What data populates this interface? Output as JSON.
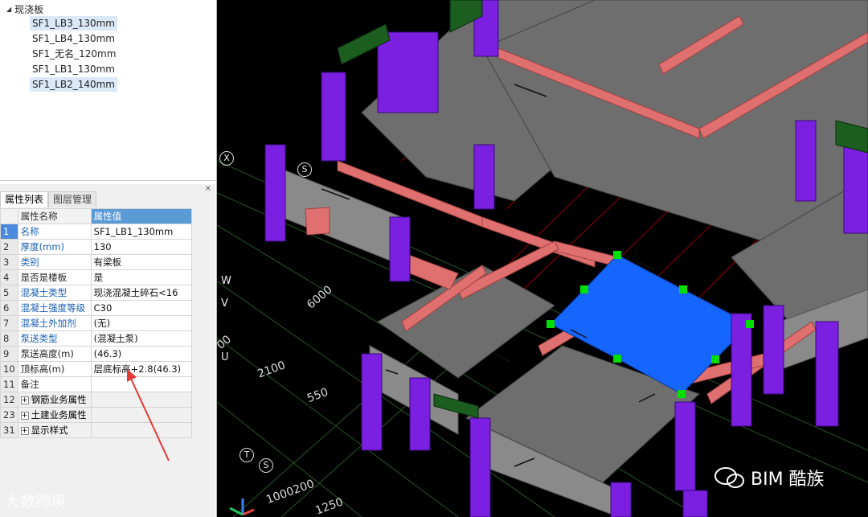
{
  "tree": {
    "root_label": "现浇板",
    "items": [
      {
        "label": "SF1_LB3_130mm",
        "selected": true
      },
      {
        "label": "SF1_LB4_130mm",
        "selected": false
      },
      {
        "label": "SF1_无名_120mm",
        "selected": false
      },
      {
        "label": "SF1_LB1_130mm",
        "selected": false
      },
      {
        "label": "SF1_LB2_140mm",
        "selected": true
      }
    ]
  },
  "panel": {
    "close_label": "×",
    "tabs": [
      {
        "label": "属性列表",
        "active": true
      },
      {
        "label": "图层管理",
        "active": false
      }
    ],
    "headers": {
      "name": "属性名称",
      "value": "属性值"
    },
    "rows": [
      {
        "num": "1",
        "name": "名称",
        "value": "SF1_LB1_130mm",
        "blue": true
      },
      {
        "num": "2",
        "name": "厚度(mm)",
        "value": "130",
        "blue": true
      },
      {
        "num": "3",
        "name": "类别",
        "value": "有梁板",
        "blue": true
      },
      {
        "num": "4",
        "name": "是否是楼板",
        "value": "是",
        "blue": false
      },
      {
        "num": "5",
        "name": "混凝土类型",
        "value": "现浇混凝土碎石<16",
        "blue": true
      },
      {
        "num": "6",
        "name": "混凝土强度等级",
        "value": "C30",
        "blue": true
      },
      {
        "num": "7",
        "name": "混凝土外加剂",
        "value": "(无)",
        "blue": true
      },
      {
        "num": "8",
        "name": "泵送类型",
        "value": "(混凝土泵)",
        "blue": true
      },
      {
        "num": "9",
        "name": "泵送高度(m)",
        "value": "(46.3)",
        "blue": false
      },
      {
        "num": "10",
        "name": "顶标高(m)",
        "value": "层底标高+2.8(46.3)",
        "blue": false
      },
      {
        "num": "11",
        "name": "备注",
        "value": "",
        "blue": false
      }
    ],
    "groups": [
      {
        "num": "12",
        "label": "钢筋业务属性"
      },
      {
        "num": "23",
        "label": "土建业务属性"
      },
      {
        "num": "31",
        "label": "显示样式"
      }
    ]
  },
  "viewport": {
    "axis_labels": [
      "X",
      "S",
      "W",
      "V",
      "U",
      "T",
      "S"
    ],
    "dimensions": [
      "6000",
      "00",
      "2100",
      "550",
      "1000200",
      "1250"
    ],
    "selected_slab_color": "#1565ff",
    "beam_color": "#e07070",
    "column_color": "#7b1fe0",
    "slab_color": "#6e6e6e",
    "grip_color": "#00e000"
  },
  "watermarks": {
    "left": "大数跨境",
    "right": "BIM 酷族"
  }
}
